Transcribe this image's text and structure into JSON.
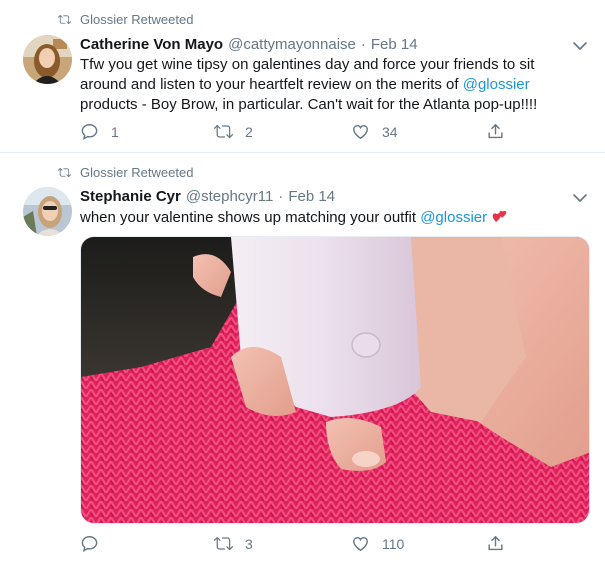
{
  "tweets": [
    {
      "retweeted_by": "Glossier Retweeted",
      "name": "Catherine Von Mayo",
      "handle": "@cattymayonnaise",
      "dot": "·",
      "date": "Feb 14",
      "text_part1": "Tfw you get wine tipsy on galentines day and force your friends to sit around and listen to your heartfelt review on the merits of ",
      "mention": "@glossier",
      "text_part2": " products - Boy Brow, in particular. Can't wait for the Atlanta pop-up!!!!",
      "replies": "1",
      "retweets": "2",
      "likes": "34"
    },
    {
      "retweeted_by": "Glossier Retweeted",
      "name": "Stephanie Cyr",
      "handle": "@stephcyr11",
      "dot": "·",
      "date": "Feb 14",
      "text_part1": "when your valentine shows up matching your outfit ",
      "mention": "@glossier",
      "replies": "",
      "retweets": "3",
      "likes": "110"
    }
  ],
  "icons": {
    "retweet": "retweet-icon",
    "reply": "reply-icon",
    "like": "heart-icon",
    "share": "share-icon",
    "menu": "chevron-down-icon",
    "emoji": "two-hearts-emoji"
  },
  "colors": {
    "link": "#1b95e0",
    "secondary": "#657786",
    "primary_text": "#14171a",
    "divider": "#e6ecf0"
  }
}
